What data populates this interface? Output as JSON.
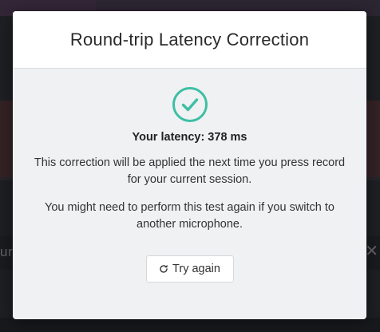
{
  "modal": {
    "title": "Round-trip Latency Correction",
    "status_icon": "check-circle-icon",
    "latency_text": "Your latency: 378 ms",
    "message_1": "This correction will be applied the next time you press record for your current session.",
    "message_2": "You might need to perform this test again if you switch to another microphone.",
    "retry_button": {
      "icon": "refresh-icon",
      "label": "Try again"
    }
  },
  "background": {
    "partial_label": "ur",
    "close_icon": "close-icon"
  },
  "colors": {
    "success_accent": "#3dbfa5",
    "track_color": "#5b3336",
    "topbar_color": "#4a3a52"
  }
}
